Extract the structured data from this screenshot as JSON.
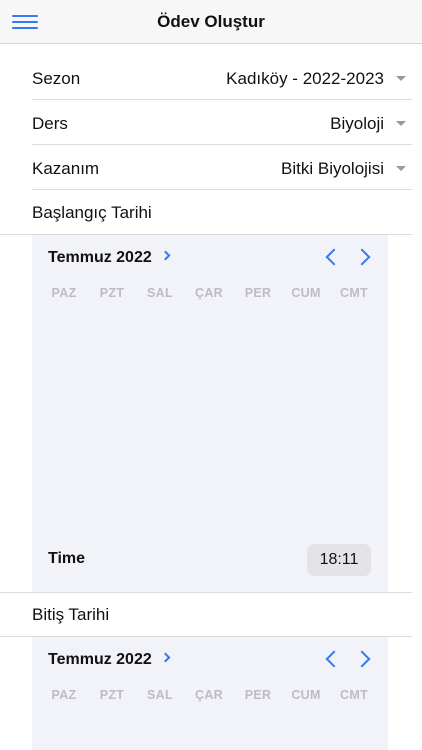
{
  "header": {
    "title": "Ödev Oluştur",
    "menu_icon": "hamburger-menu-icon"
  },
  "form": {
    "season": {
      "label": "Sezon",
      "value": "Kadıköy - 2022-2023"
    },
    "course": {
      "label": "Ders",
      "value": "Biyoloji"
    },
    "objective": {
      "label": "Kazanım",
      "value": "Bitki Biyolojisi"
    }
  },
  "start": {
    "label": "Başlangıç Tarihi",
    "calendar": {
      "month": "Temmuz 2022",
      "weekdays": [
        "PAZ",
        "PZT",
        "SAL",
        "ÇAR",
        "PER",
        "CUM",
        "CMT"
      ]
    },
    "time": {
      "label": "Time",
      "value": "18:11"
    }
  },
  "end": {
    "label": "Bitiş Tarihi",
    "calendar": {
      "month": "Temmuz 2022",
      "weekdays": [
        "PAZ",
        "PZT",
        "SAL",
        "ÇAR",
        "PER",
        "CUM",
        "CMT"
      ]
    }
  },
  "colors": {
    "accent": "#3478f6",
    "calendar_bg": "#f2f3f8",
    "weekday": "#bcbcc2"
  }
}
